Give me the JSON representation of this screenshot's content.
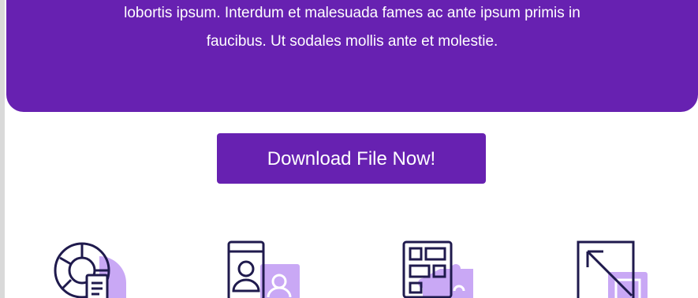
{
  "banner": {
    "line1": "lobortis ipsum. Interdum et malesuada fames ac ante ipsum primis in",
    "line2": "faucibus. Ut sodales mollis ante et molestie."
  },
  "download_button": {
    "label": "Download File Now!"
  },
  "feature_icons": [
    {
      "icon": "pie-chart-report-icon"
    },
    {
      "icon": "user-profile-icon"
    },
    {
      "icon": "puzzle-layout-icon"
    },
    {
      "icon": "expand-arrow-icon"
    }
  ],
  "colors": {
    "brand_purple": "#6721b1",
    "icon_outline": "#1f1a4d",
    "icon_accent": "#c9a8f5",
    "text_on_brand": "#ffffff"
  }
}
